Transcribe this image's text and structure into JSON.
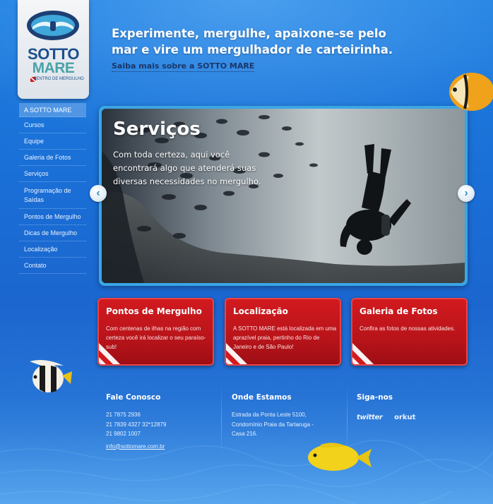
{
  "brand": {
    "logo_top": "SOTTO",
    "logo_bottom": "MARE",
    "logo_sub": "CENTRO DE MERGULHO"
  },
  "header": {
    "headline": "Experimente, mergulhe, apaixone-se pelo mar e vire um mergulhador de carteirinha.",
    "more_link": "Saiba mais sobre a SOTTO MARE"
  },
  "nav": {
    "items": [
      {
        "label": "A SOTTO MARE"
      },
      {
        "label": "Cursos"
      },
      {
        "label": "Equipe"
      },
      {
        "label": "Galeria de Fotos"
      },
      {
        "label": "Serviços"
      },
      {
        "label": "Programação de Saídas"
      },
      {
        "label": "Pontos de Mergulho"
      },
      {
        "label": "Dicas de Mergulho"
      },
      {
        "label": "Localização"
      },
      {
        "label": "Contato"
      }
    ]
  },
  "slider": {
    "title": "Serviços",
    "text": "Com toda certeza, aqui você encontrará algo que atenderá suas diversas necessidades no mergulho.",
    "prev_glyph": "‹",
    "next_glyph": "›"
  },
  "boxes": [
    {
      "title": "Pontos de Mergulho",
      "text": "Com centenas de ilhas na região com certeza você irá localizar o seu paraíso-sub!"
    },
    {
      "title": "Localização",
      "text": "A SOTTO MARE está localizada em uma aprazível praia, pertinho do Rio de Janeiro e de São Paulo!"
    },
    {
      "title": "Galeria de Fotos",
      "text": "Confira as fotos de nossas atividades."
    }
  ],
  "footer": {
    "contact": {
      "title": "Fale Conosco",
      "phones": [
        "21 7875 2936",
        "21 7839 4327 32*12879",
        "21 9802 1007"
      ],
      "email": "info@sottomare.com.br"
    },
    "address": {
      "title": "Onde Estamos",
      "lines": [
        "Estrada da Ponta Leste 5100,",
        "Condomínio Praia da Tartaruga -",
        "Casa 216."
      ]
    },
    "social": {
      "title": "Siga-nos",
      "twitter": "twitter",
      "orkut": "orkut"
    }
  },
  "colors": {
    "ocean": "#1b6fd6",
    "box_red": "#c8171c",
    "nav_active": "#78afeb"
  }
}
